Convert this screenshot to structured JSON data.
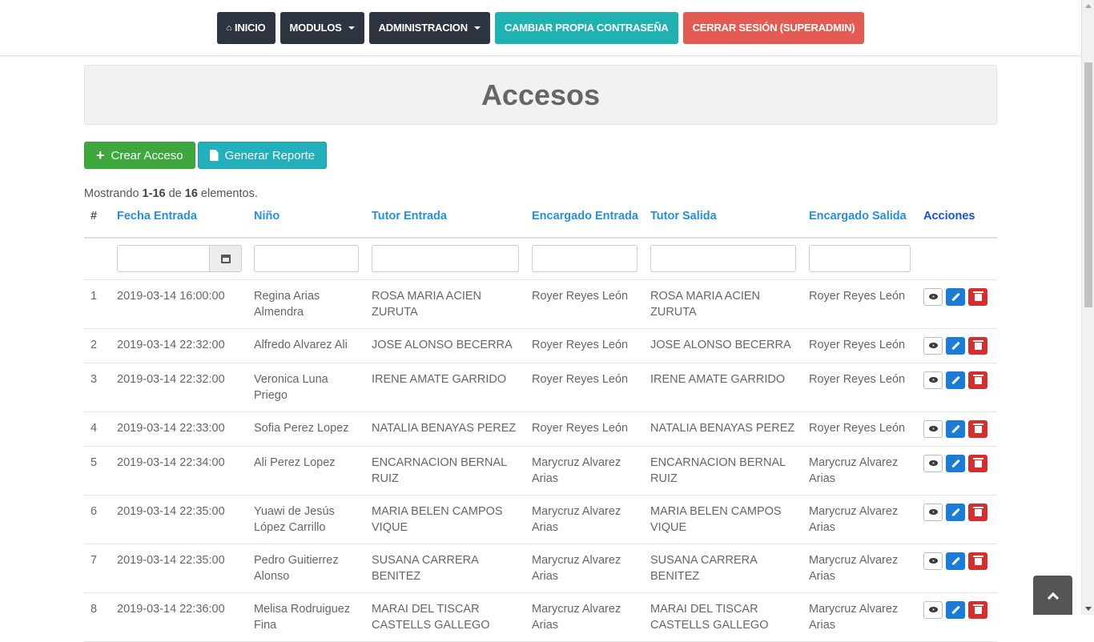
{
  "nav": {
    "inicio": "INICIO",
    "modulos": "MODULOS",
    "administracion": "ADMINISTRACION",
    "cambiar": "CAMBIAR PROPIA CONTRASEÑA",
    "cerrar": "CERRAR SESIÓN (SUPERADMIN)",
    "home_icon": "home-icon"
  },
  "page": {
    "title": "Accesos",
    "crear": "Crear Acceso",
    "reporte": "Generar Reporte",
    "summary_pre": "Mostrando ",
    "summary_range": "1-16",
    "summary_mid": " de ",
    "summary_total": "16",
    "summary_post": " elementos."
  },
  "table": {
    "headers": [
      "#",
      "Fecha Entrada",
      "Niño",
      "Tutor Entrada",
      "Encargado Entrada",
      "Tutor Salida",
      "Encargado Salida",
      "Acciones"
    ],
    "rows": [
      [
        "1",
        "2019-03-14 16:00:00",
        "Regina Arias Almendra",
        "ROSA MARIA ACIEN ZURUTA",
        "Royer Reyes León",
        "ROSA MARIA ACIEN ZURUTA",
        "Royer Reyes León"
      ],
      [
        "2",
        "2019-03-14 22:32:00",
        "Alfredo Alvarez Ali",
        "JOSE ALONSO BECERRA",
        "Royer Reyes León",
        "JOSE ALONSO BECERRA",
        "Royer Reyes León"
      ],
      [
        "3",
        "2019-03-14 22:32:00",
        "Veronica Luna Priego",
        "IRENE AMATE GARRIDO",
        "Royer Reyes León",
        "IRENE AMATE GARRIDO",
        "Royer Reyes León"
      ],
      [
        "4",
        "2019-03-14 22:33:00",
        "Sofia Perez Lopez",
        "NATALIA BENAYAS PEREZ",
        "Royer Reyes León",
        "NATALIA BENAYAS PEREZ",
        "Royer Reyes León"
      ],
      [
        "5",
        "2019-03-14 22:34:00",
        "Ali Perez Lopez",
        "ENCARNACION BERNAL RUIZ",
        "Marycruz Alvarez Arias",
        "ENCARNACION BERNAL RUIZ",
        "Marycruz Alvarez Arias"
      ],
      [
        "6",
        "2019-03-14 22:35:00",
        "Yuawi de Jesús López Carrillo",
        "MARIA BELEN CAMPOS VIQUE",
        "Marycruz Alvarez Arias",
        "MARIA BELEN CAMPOS VIQUE",
        "Marycruz Alvarez Arias"
      ],
      [
        "7",
        "2019-03-14 22:35:00",
        "Pedro Guitierrez Alonso",
        "SUSANA CARRERA BENITEZ",
        "Marycruz Alvarez Arias",
        "SUSANA CARRERA BENITEZ",
        "Marycruz Alvarez Arias"
      ],
      [
        "8",
        "2019-03-14 22:36:00",
        "Melisa Rodruiguez Fina",
        "MARAI DEL TISCAR CASTELLS GALLEGO",
        "Marycruz Alvarez Arias",
        "MARAI DEL TISCAR CASTELLS GALLEGO",
        "Marycruz Alvarez Arias"
      ]
    ]
  },
  "colors": {
    "nav_dark": "#2e3440",
    "teal": "#20b2b2",
    "red": "#e45b53",
    "green": "#3ea83e",
    "link": "#2a8fd8"
  },
  "icons": {
    "view": "eye-icon",
    "edit": "pencil-icon",
    "delete": "trash-icon",
    "calendar": "calendar-icon",
    "back_to_top": "chevron-up-icon"
  }
}
